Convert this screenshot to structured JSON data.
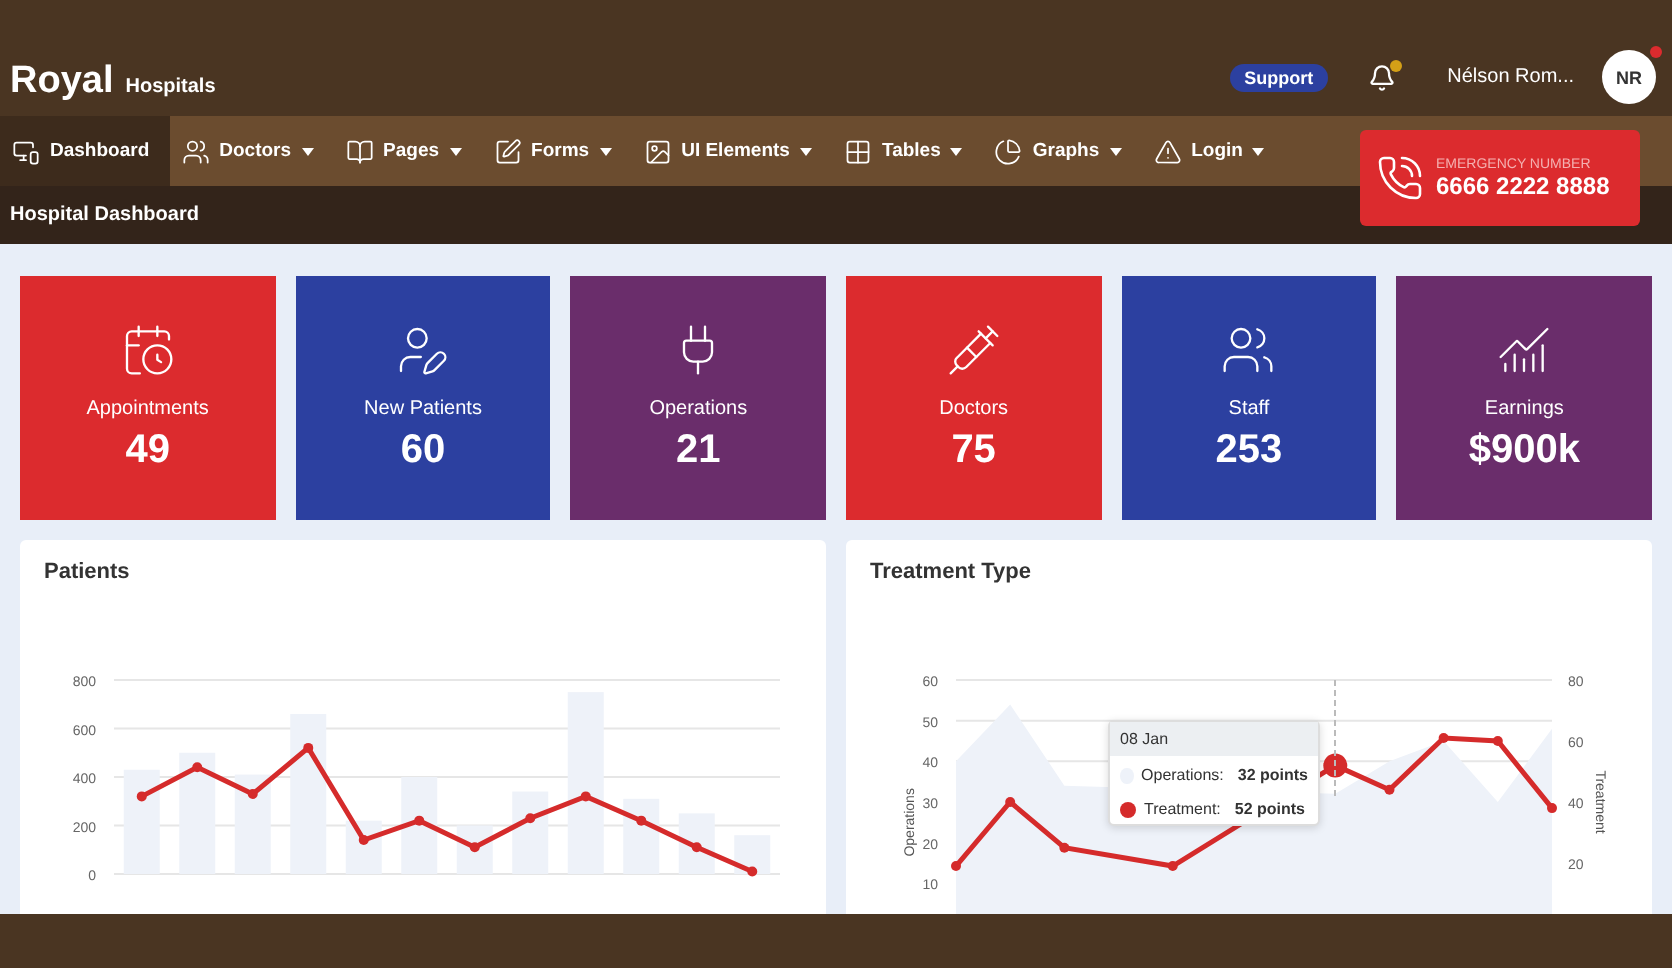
{
  "brand": {
    "name": "Royal",
    "suffix": "Hospitals"
  },
  "header": {
    "support": "Support",
    "user_name": "Nélson Rom...",
    "avatar": "NR"
  },
  "nav": [
    {
      "label": "Dashboard",
      "selected": true,
      "caret": false
    },
    {
      "label": "Doctors",
      "selected": false,
      "caret": true
    },
    {
      "label": "Pages",
      "selected": false,
      "caret": true
    },
    {
      "label": "Forms",
      "selected": false,
      "caret": true
    },
    {
      "label": "UI Elements",
      "selected": false,
      "caret": true
    },
    {
      "label": "Tables",
      "selected": false,
      "caret": true
    },
    {
      "label": "Graphs",
      "selected": false,
      "caret": true
    },
    {
      "label": "Login",
      "selected": false,
      "caret": true
    }
  ],
  "emergency": {
    "label": "EMERGENCY NUMBER",
    "number": "6666 2222 8888"
  },
  "page_title": "Hospital Dashboard",
  "stats": [
    {
      "label": "Appointments",
      "value": "49",
      "color": "#dc2b2e"
    },
    {
      "label": "New Patients",
      "value": "60",
      "color": "#2c40a0"
    },
    {
      "label": "Operations",
      "value": "21",
      "color": "#6a2d6b"
    },
    {
      "label": "Doctors",
      "value": "75",
      "color": "#dc2b2e"
    },
    {
      "label": "Staff",
      "value": "253",
      "color": "#2c40a0"
    },
    {
      "label": "Earnings",
      "value": "$900k",
      "color": "#6a2d6b"
    }
  ],
  "patients": {
    "title": "Patients",
    "chart_data": {
      "type": "bar",
      "grid": true,
      "ylim": [
        0,
        800
      ],
      "yticks": [
        0,
        200,
        400,
        600,
        800
      ],
      "series": [
        {
          "type": "bar",
          "color": "#eef2f9",
          "values": [
            430,
            500,
            410,
            660,
            220,
            400,
            200,
            340,
            750,
            310,
            250,
            160
          ]
        },
        {
          "type": "line",
          "marker": "o",
          "color": "#d52b2b",
          "values": [
            320,
            440,
            330,
            520,
            140,
            220,
            110,
            230,
            320,
            220,
            110,
            10
          ]
        }
      ]
    }
  },
  "treatment": {
    "title": "Treatment Type",
    "chart_data": {
      "type": "area",
      "grid": true,
      "ylabel": "Operations",
      "y2label": "Treatment",
      "ylim": [
        0,
        60
      ],
      "y2lim": [
        0,
        80
      ],
      "yticks": [
        10,
        20,
        30,
        40,
        50,
        60
      ],
      "y2ticks": [
        20,
        40,
        60,
        80
      ],
      "series": [
        {
          "type": "area",
          "color": "#eef2f9",
          "values": [
            40,
            54,
            34,
            null,
            null,
            null,
            null,
            32,
            40,
            45,
            30,
            48
          ]
        },
        {
          "type": "line",
          "marker": "o",
          "axis": "y2",
          "color": "#d52b2b",
          "values": [
            19,
            40,
            25,
            null,
            19,
            null,
            null,
            52,
            44,
            61,
            60,
            38
          ]
        }
      ]
    },
    "tooltip": {
      "title": "08 Jan",
      "rows": [
        {
          "label": "Operations:",
          "value": "32 points",
          "color": "#eef2f9"
        },
        {
          "label": "Treatment:",
          "value": "52 points",
          "color": "#d52b2b"
        }
      ]
    }
  }
}
